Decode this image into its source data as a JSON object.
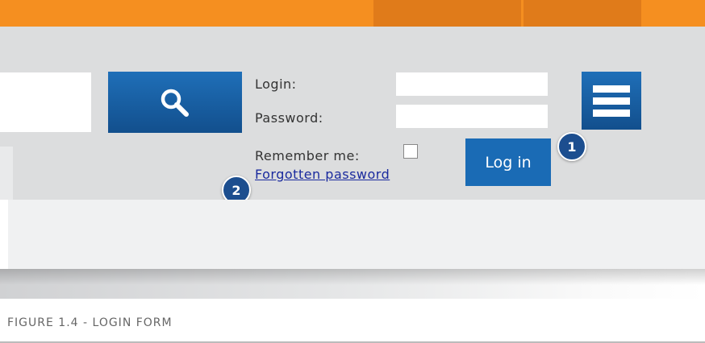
{
  "topbar": {
    "color": "#f58f20",
    "tab_color": "#e07b1a"
  },
  "search": {
    "value": "",
    "button_icon": "search-icon"
  },
  "login_form": {
    "login_label": "Login:",
    "password_label": "Password:",
    "login_value": "",
    "password_value": "",
    "remember_label": "Remember me:",
    "remember_checked": false,
    "forgot_link": "Forgotten password",
    "submit_label": "Log in",
    "accent_color": "#1a6bb5"
  },
  "menu_button": {
    "icon": "hamburger-menu-icon"
  },
  "callouts": [
    {
      "number": "1"
    },
    {
      "number": "2"
    }
  ],
  "caption": "FIGURE 1.4 - LOGIN FORM"
}
